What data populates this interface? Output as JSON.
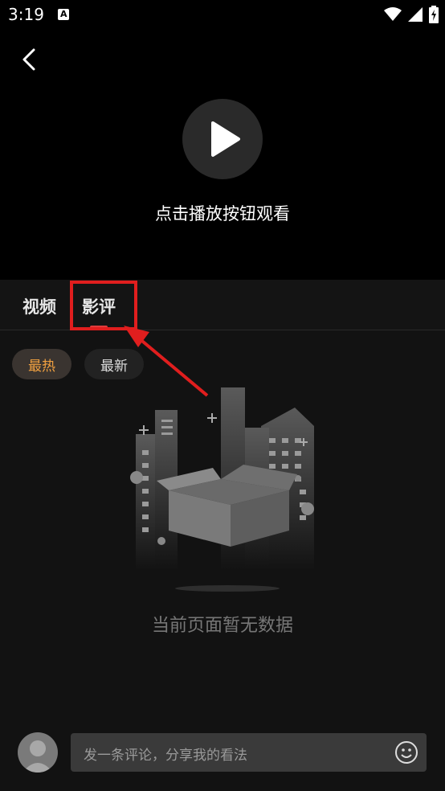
{
  "status_bar": {
    "time": "3:19",
    "a_icon": "A"
  },
  "player": {
    "hint": "点击播放按钮观看"
  },
  "tabs": [
    {
      "label": "视频"
    },
    {
      "label": "影评"
    }
  ],
  "filters": [
    {
      "label": "最热"
    },
    {
      "label": "最新"
    }
  ],
  "empty_state": {
    "message": "当前页面暂无数据"
  },
  "comment": {
    "placeholder": "发一条评论，分享我的看法"
  },
  "colors": {
    "accent": "#f0a040",
    "annotation": "#e01e1e"
  }
}
